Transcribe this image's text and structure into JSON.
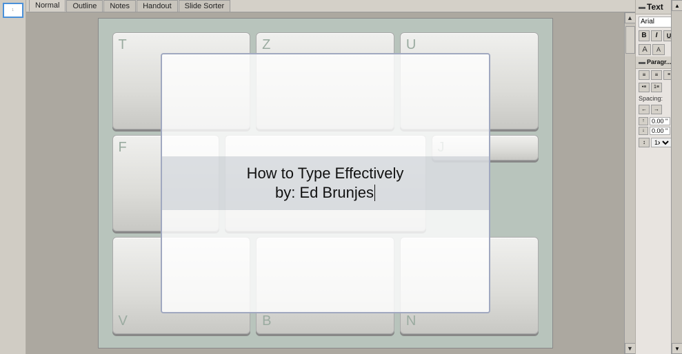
{
  "tabs": {
    "items": [
      "Normal",
      "Outline",
      "Notes",
      "Handout",
      "Slide Sorter"
    ]
  },
  "slide": {
    "title": "How to Type Effectively",
    "subtitle": "by:  Ed Brunjes"
  },
  "keyboard": {
    "row1": [
      "T",
      "Z",
      "U"
    ],
    "row2": [
      "F",
      "",
      "J"
    ],
    "row3": [
      "V",
      "B",
      "N"
    ]
  },
  "properties": {
    "section_text": "Text",
    "font_name": "Arial",
    "btn_bold": "B",
    "btn_italic": "I",
    "btn_underline": "U",
    "section_paragraph": "Paragr...",
    "spacing_label": "Spacing:",
    "above_value": "0.00 \"",
    "below_value": "0.00 \""
  }
}
